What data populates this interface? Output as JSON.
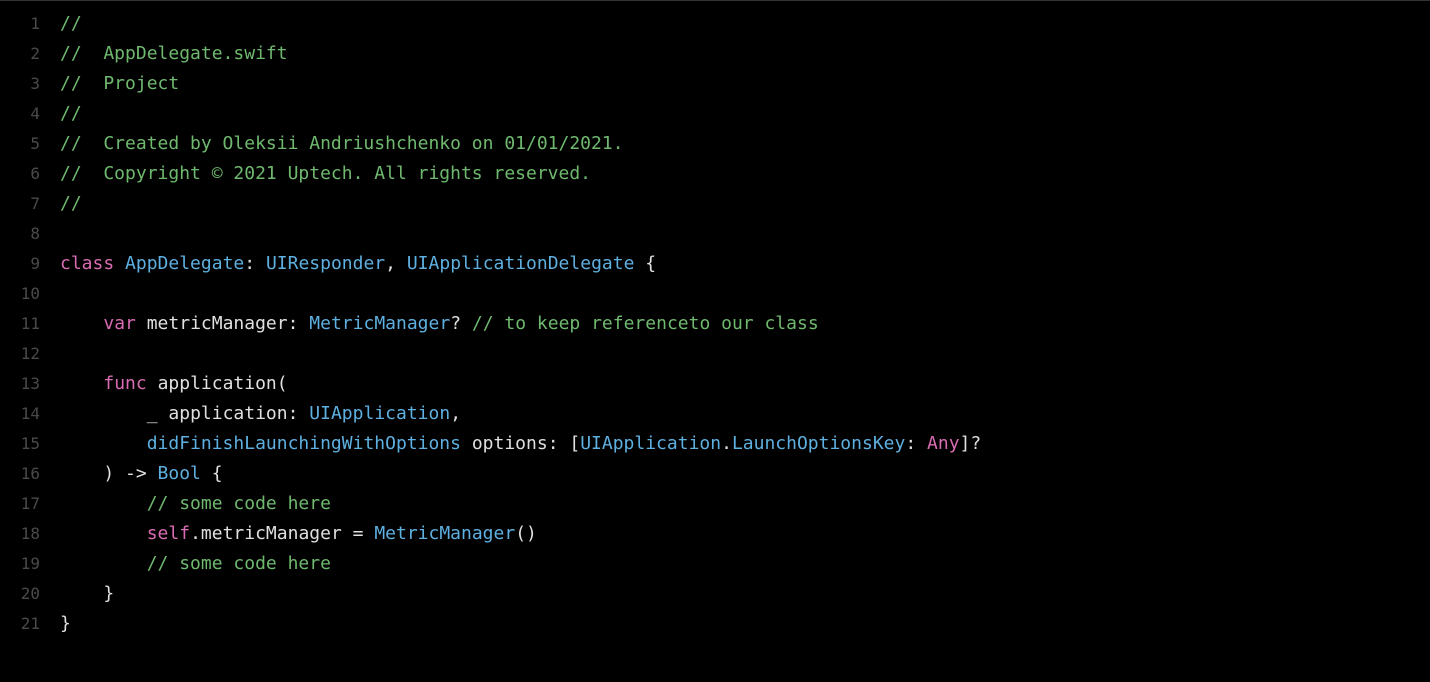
{
  "lineNumbers": [
    "1",
    "2",
    "3",
    "4",
    "5",
    "6",
    "7",
    "8",
    "9",
    "10",
    "11",
    "12",
    "13",
    "14",
    "15",
    "16",
    "17",
    "18",
    "19",
    "20",
    "21"
  ],
  "lines": [
    [
      {
        "t": "comment",
        "v": "//"
      }
    ],
    [
      {
        "t": "comment",
        "v": "//  AppDelegate.swift"
      }
    ],
    [
      {
        "t": "comment",
        "v": "//  Project"
      }
    ],
    [
      {
        "t": "comment",
        "v": "//"
      }
    ],
    [
      {
        "t": "comment",
        "v": "//  Created by Oleksii Andriushchenko on 01/01/2021."
      }
    ],
    [
      {
        "t": "comment",
        "v": "//  Copyright © 2021 Uptech. All rights reserved."
      }
    ],
    [
      {
        "t": "comment",
        "v": "//"
      }
    ],
    [],
    [
      {
        "t": "keyword",
        "v": "class"
      },
      {
        "t": "punct",
        "v": " "
      },
      {
        "t": "type",
        "v": "AppDelegate"
      },
      {
        "t": "punct",
        "v": ": "
      },
      {
        "t": "type",
        "v": "UIResponder"
      },
      {
        "t": "punct",
        "v": ", "
      },
      {
        "t": "type",
        "v": "UIApplicationDelegate"
      },
      {
        "t": "punct",
        "v": " {"
      }
    ],
    [],
    [
      {
        "t": "punct",
        "v": "    "
      },
      {
        "t": "keyword",
        "v": "var"
      },
      {
        "t": "punct",
        "v": " "
      },
      {
        "t": "identifier",
        "v": "metricManager"
      },
      {
        "t": "punct",
        "v": ": "
      },
      {
        "t": "type",
        "v": "MetricManager"
      },
      {
        "t": "punct",
        "v": "? "
      },
      {
        "t": "comment",
        "v": "// to keep referenceto our class"
      }
    ],
    [],
    [
      {
        "t": "punct",
        "v": "    "
      },
      {
        "t": "keyword",
        "v": "func"
      },
      {
        "t": "punct",
        "v": " "
      },
      {
        "t": "funcname",
        "v": "application"
      },
      {
        "t": "punct",
        "v": "("
      }
    ],
    [
      {
        "t": "punct",
        "v": "        "
      },
      {
        "t": "identifier",
        "v": "_"
      },
      {
        "t": "punct",
        "v": " "
      },
      {
        "t": "identifier",
        "v": "application"
      },
      {
        "t": "punct",
        "v": ": "
      },
      {
        "t": "type",
        "v": "UIApplication"
      },
      {
        "t": "punct",
        "v": ","
      }
    ],
    [
      {
        "t": "punct",
        "v": "        "
      },
      {
        "t": "param",
        "v": "didFinishLaunchingWithOptions"
      },
      {
        "t": "punct",
        "v": " "
      },
      {
        "t": "identifier",
        "v": "options"
      },
      {
        "t": "punct",
        "v": ": ["
      },
      {
        "t": "type",
        "v": "UIApplication"
      },
      {
        "t": "punct",
        "v": "."
      },
      {
        "t": "type",
        "v": "LaunchOptionsKey"
      },
      {
        "t": "punct",
        "v": ": "
      },
      {
        "t": "keyword",
        "v": "Any"
      },
      {
        "t": "punct",
        "v": "]?"
      }
    ],
    [
      {
        "t": "punct",
        "v": "    ) -> "
      },
      {
        "t": "type",
        "v": "Bool"
      },
      {
        "t": "punct",
        "v": " {"
      }
    ],
    [
      {
        "t": "punct",
        "v": "        "
      },
      {
        "t": "comment",
        "v": "// some code here"
      }
    ],
    [
      {
        "t": "punct",
        "v": "        "
      },
      {
        "t": "self",
        "v": "self"
      },
      {
        "t": "punct",
        "v": "."
      },
      {
        "t": "property",
        "v": "metricManager"
      },
      {
        "t": "punct",
        "v": " = "
      },
      {
        "t": "type",
        "v": "MetricManager"
      },
      {
        "t": "punct",
        "v": "()"
      }
    ],
    [
      {
        "t": "punct",
        "v": "        "
      },
      {
        "t": "comment",
        "v": "// some code here"
      }
    ],
    [
      {
        "t": "punct",
        "v": "    }"
      }
    ],
    [
      {
        "t": "punct",
        "v": "}"
      }
    ]
  ]
}
